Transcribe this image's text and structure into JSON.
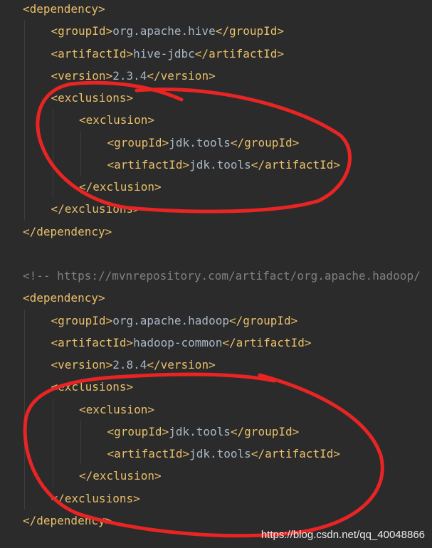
{
  "editor": {
    "language": "xml",
    "theme": "dark",
    "colors": {
      "background": "#2b2b2b",
      "tag": "#e8bf6a",
      "text": "#a9b7c6",
      "comment": "#808080",
      "annotation": "#e82424"
    },
    "lines": [
      {
        "kind": "open",
        "depth": 0,
        "tag": "dependency"
      },
      {
        "kind": "element",
        "depth": 1,
        "tag": "groupId",
        "value": "org.apache.hive"
      },
      {
        "kind": "element",
        "depth": 1,
        "tag": "artifactId",
        "value": "hive-jdbc"
      },
      {
        "kind": "element",
        "depth": 1,
        "tag": "version",
        "value": "2.3.4"
      },
      {
        "kind": "open",
        "depth": 1,
        "tag": "exclusions"
      },
      {
        "kind": "open",
        "depth": 2,
        "tag": "exclusion"
      },
      {
        "kind": "element",
        "depth": 3,
        "tag": "groupId",
        "value": "jdk.tools"
      },
      {
        "kind": "element",
        "depth": 3,
        "tag": "artifactId",
        "value": "jdk.tools"
      },
      {
        "kind": "close",
        "depth": 2,
        "tag": "exclusion"
      },
      {
        "kind": "close",
        "depth": 1,
        "tag": "exclusions"
      },
      {
        "kind": "close",
        "depth": 0,
        "tag": "dependency"
      },
      {
        "kind": "blank"
      },
      {
        "kind": "comment",
        "depth": 0,
        "text": "<!-- https://mvnrepository.com/artifact/org.apache.hadoop/"
      },
      {
        "kind": "open",
        "depth": 0,
        "tag": "dependency"
      },
      {
        "kind": "element",
        "depth": 1,
        "tag": "groupId",
        "value": "org.apache.hadoop"
      },
      {
        "kind": "element",
        "depth": 1,
        "tag": "artifactId",
        "value": "hadoop-common"
      },
      {
        "kind": "element",
        "depth": 1,
        "tag": "version",
        "value": "2.8.4"
      },
      {
        "kind": "open",
        "depth": 1,
        "tag": "exclusions"
      },
      {
        "kind": "open",
        "depth": 2,
        "tag": "exclusion"
      },
      {
        "kind": "element",
        "depth": 3,
        "tag": "groupId",
        "value": "jdk.tools"
      },
      {
        "kind": "element",
        "depth": 3,
        "tag": "artifactId",
        "value": "jdk.tools"
      },
      {
        "kind": "close",
        "depth": 2,
        "tag": "exclusion"
      },
      {
        "kind": "close",
        "depth": 1,
        "tag": "exclusions"
      },
      {
        "kind": "close",
        "depth": 0,
        "tag": "dependency"
      }
    ]
  },
  "annotations": [
    {
      "shape": "hand-drawn-ellipse",
      "color": "#e82424",
      "target": "hive-jdbc exclusions block"
    },
    {
      "shape": "hand-drawn-ellipse",
      "color": "#e82424",
      "target": "hadoop-common exclusions block"
    }
  ],
  "watermark": {
    "text": "https://blog.csdn.net/qq_40048866"
  }
}
